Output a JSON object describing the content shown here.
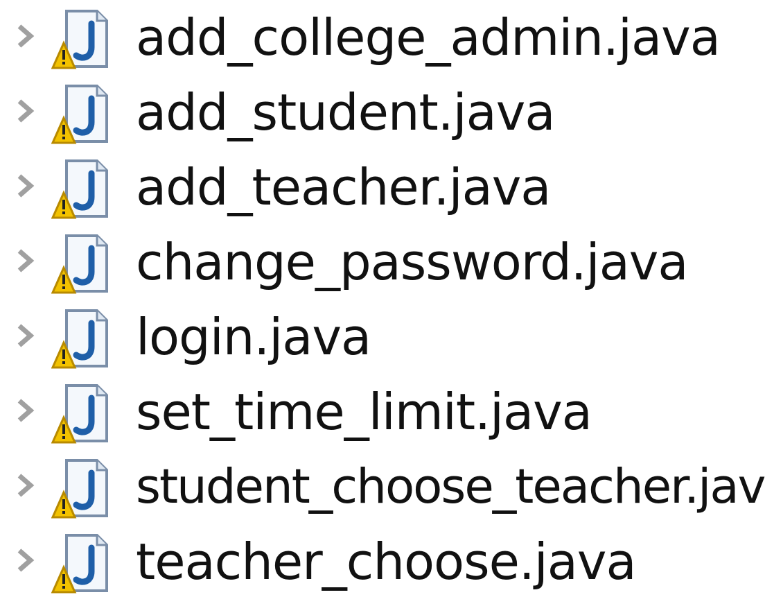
{
  "file_tree": {
    "items": [
      {
        "label": "add_college_admin.java",
        "icon": "java-file-warning-icon",
        "expander": "chevron-right-icon"
      },
      {
        "label": "add_student.java",
        "icon": "java-file-warning-icon",
        "expander": "chevron-right-icon"
      },
      {
        "label": "add_teacher.java",
        "icon": "java-file-warning-icon",
        "expander": "chevron-right-icon"
      },
      {
        "label": "change_password.java",
        "icon": "java-file-warning-icon",
        "expander": "chevron-right-icon"
      },
      {
        "label": "login.java",
        "icon": "java-file-warning-icon",
        "expander": "chevron-right-icon"
      },
      {
        "label": "set_time_limit.java",
        "icon": "java-file-warning-icon",
        "expander": "chevron-right-icon"
      },
      {
        "label": "student_choose_teacher.java",
        "icon": "java-file-warning-icon",
        "expander": "chevron-right-icon"
      },
      {
        "label": "teacher_choose.java",
        "icon": "java-file-warning-icon",
        "expander": "chevron-right-icon"
      }
    ]
  },
  "colors": {
    "text": "#111111",
    "chevron": "#a0a0a0",
    "java_j": "#1f5fa8",
    "warning": "#f2c200"
  }
}
